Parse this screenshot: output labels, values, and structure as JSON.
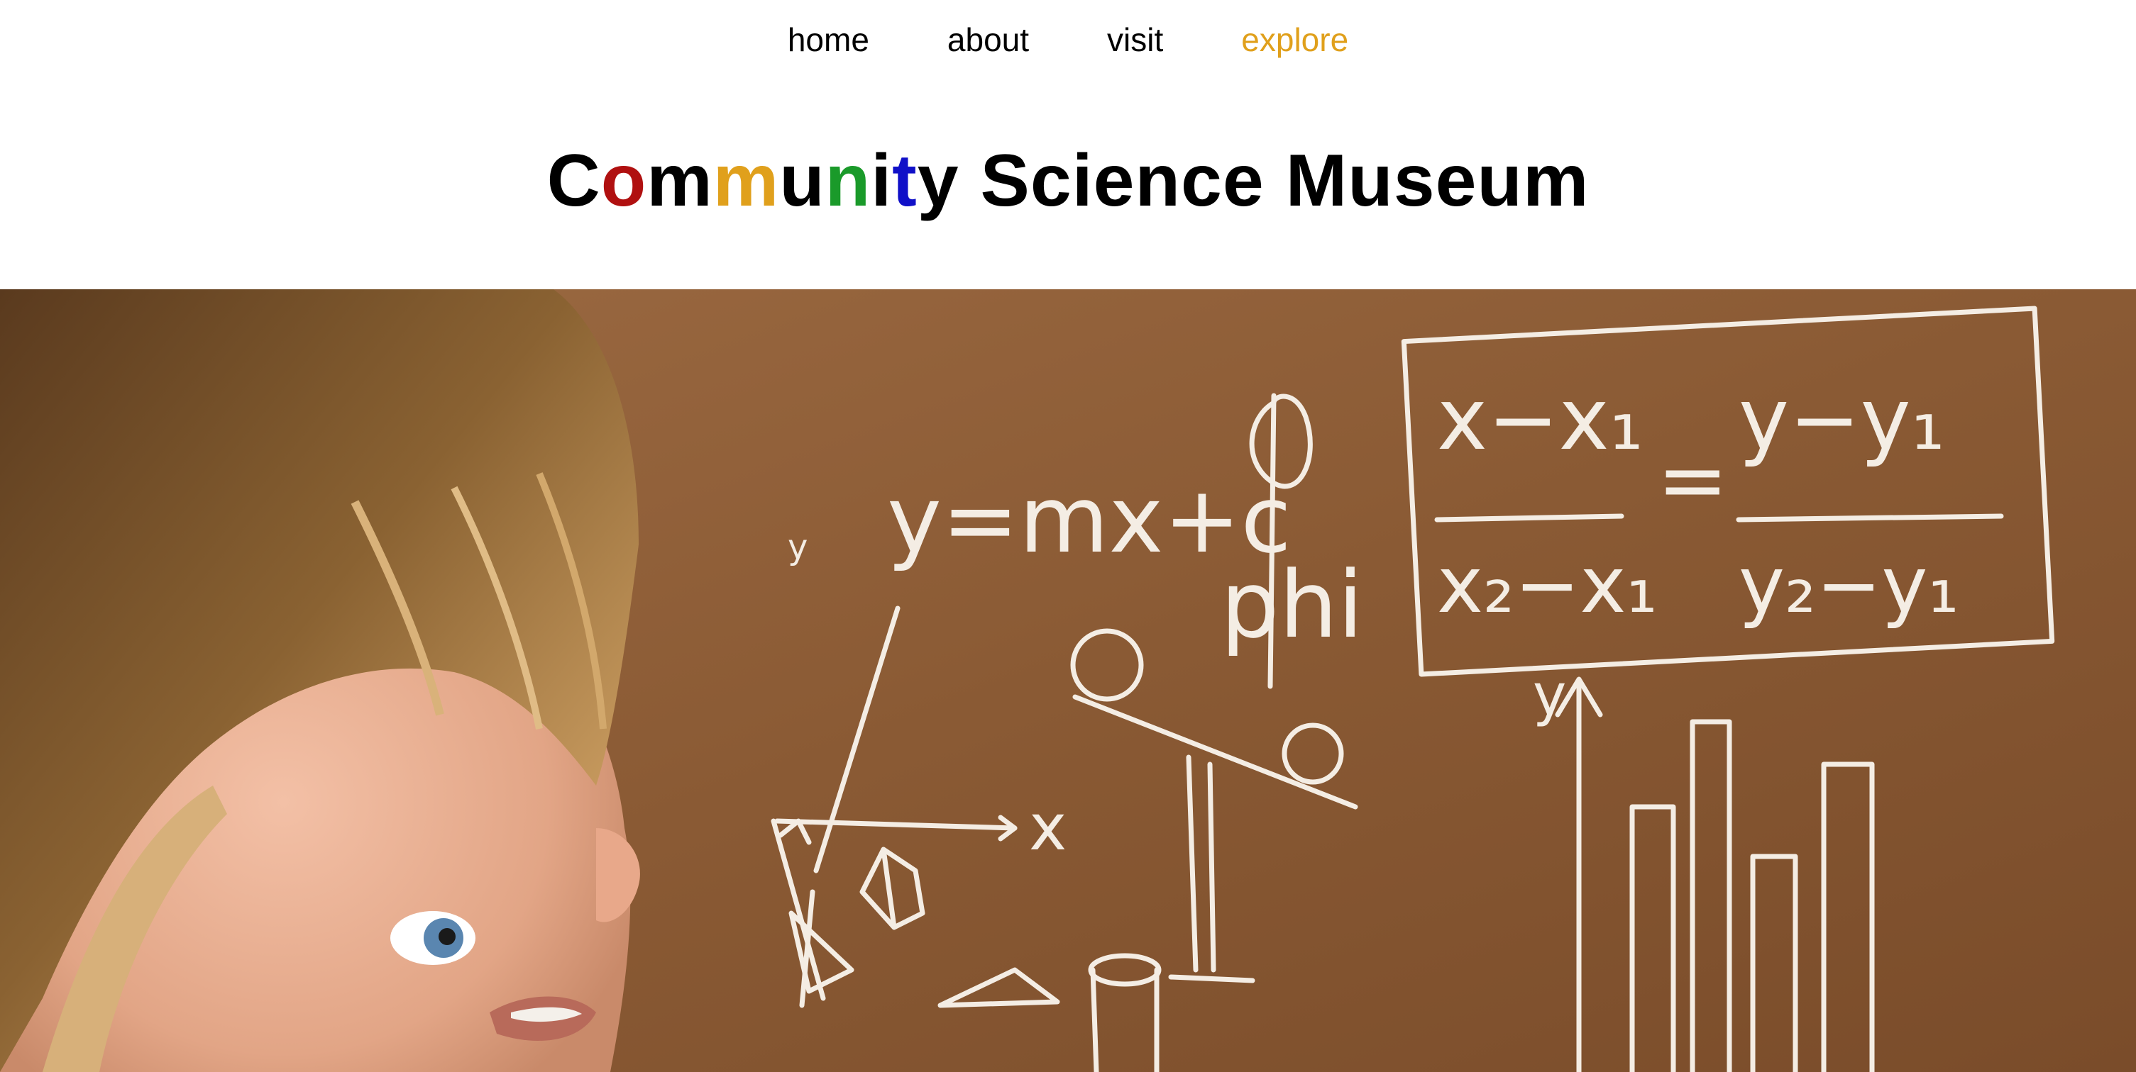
{
  "nav": {
    "items": [
      {
        "label": "home",
        "active": false
      },
      {
        "label": "about",
        "active": false
      },
      {
        "label": "visit",
        "active": false
      },
      {
        "label": "explore",
        "active": true
      }
    ],
    "active_color": "#e0a01c"
  },
  "header": {
    "title_letters": [
      {
        "ch": "C",
        "color": "#000000"
      },
      {
        "ch": "o",
        "color": "#b01010"
      },
      {
        "ch": "m",
        "color": "#000000"
      },
      {
        "ch": "m",
        "color": "#e0a01c"
      },
      {
        "ch": "u",
        "color": "#000000"
      },
      {
        "ch": "n",
        "color": "#1a9a2a"
      },
      {
        "ch": "i",
        "color": "#000000"
      },
      {
        "ch": "t",
        "color": "#1010c8"
      },
      {
        "ch": "y",
        "color": "#000000"
      },
      {
        "ch": " Science Museum",
        "color": "#000000"
      }
    ]
  },
  "hero": {
    "image_icon": "child-looking-at-chalkboard-image",
    "chalk_texts": {
      "equation": "y=mx+c",
      "phi": "phi",
      "y_axis": "y",
      "x_axis": "x",
      "formula_num_left": "x−x₁",
      "formula_num_right": "y−y₁",
      "formula_den_left": "x₂−x₁",
      "formula_den_right": "y₂−y₁",
      "equals": "=",
      "y_axis_2": "y"
    }
  }
}
